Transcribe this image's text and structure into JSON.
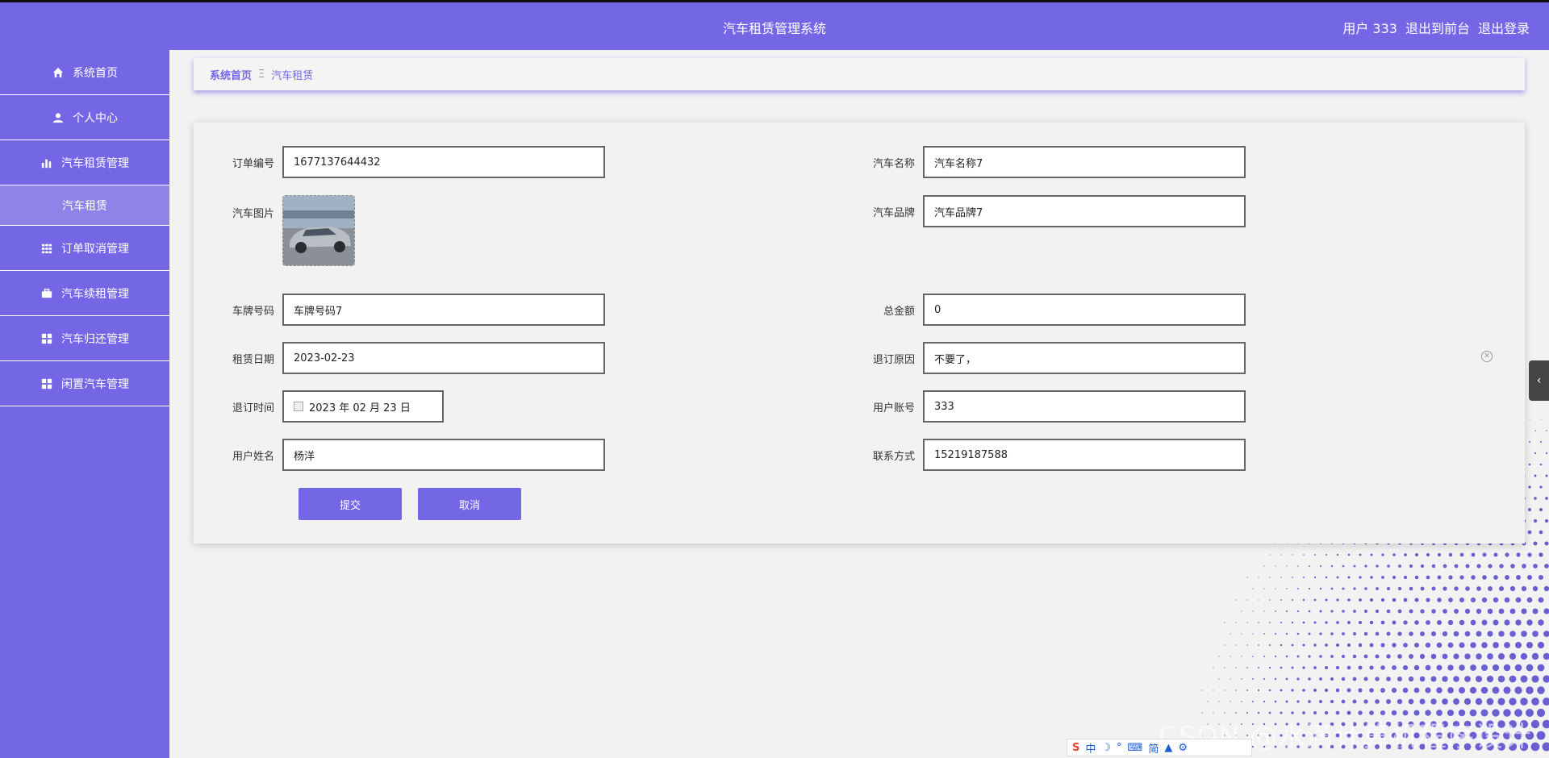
{
  "header": {
    "title": "汽车租赁管理系统",
    "user": "用户 333",
    "back_front": "退出到前台",
    "logout": "退出登录"
  },
  "sidebar": {
    "items": [
      {
        "label": "系统首页",
        "icon": "home-icon"
      },
      {
        "label": "个人中心",
        "icon": "user-icon"
      },
      {
        "label": "汽车租赁管理",
        "icon": "bar-chart-icon"
      },
      {
        "label": "汽车租赁",
        "icon": ""
      },
      {
        "label": "订单取消管理",
        "icon": "grid-icon"
      },
      {
        "label": "汽车续租管理",
        "icon": "briefcase-icon"
      },
      {
        "label": "汽车归还管理",
        "icon": "apps-icon"
      },
      {
        "label": "闲置汽车管理",
        "icon": "apps-icon"
      }
    ]
  },
  "breadcrumb": {
    "home": "系统首页",
    "sep": "Ξ",
    "current": "汽车租赁"
  },
  "form": {
    "order_no": {
      "label": "订单编号",
      "value": "1677137644432"
    },
    "car_name": {
      "label": "汽车名称",
      "value": "汽车名称7"
    },
    "car_image": {
      "label": "汽车图片"
    },
    "car_brand": {
      "label": "汽车品牌",
      "value": "汽车品牌7"
    },
    "plate_no": {
      "label": "车牌号码",
      "value": "车牌号码7"
    },
    "total_amount": {
      "label": "总金额",
      "value": "0"
    },
    "rent_date": {
      "label": "租赁日期",
      "value": "2023-02-23"
    },
    "cancel_reason": {
      "label": "退订原因",
      "value": "不要了，"
    },
    "cancel_time": {
      "label": "退订时间",
      "value": "2023 年 02 月 23 日"
    },
    "user_account": {
      "label": "用户账号",
      "value": "333"
    },
    "user_name": {
      "label": "用户姓名",
      "value": "杨洋"
    },
    "contact": {
      "label": "联系方式",
      "value": "15219187588"
    }
  },
  "buttons": {
    "submit": "提交",
    "cancel": "取消"
  },
  "watermark": "CSDN @水滴计算机程序设计",
  "colors": {
    "accent": "#7367e6",
    "sidebar_active": "#8e84e8"
  }
}
